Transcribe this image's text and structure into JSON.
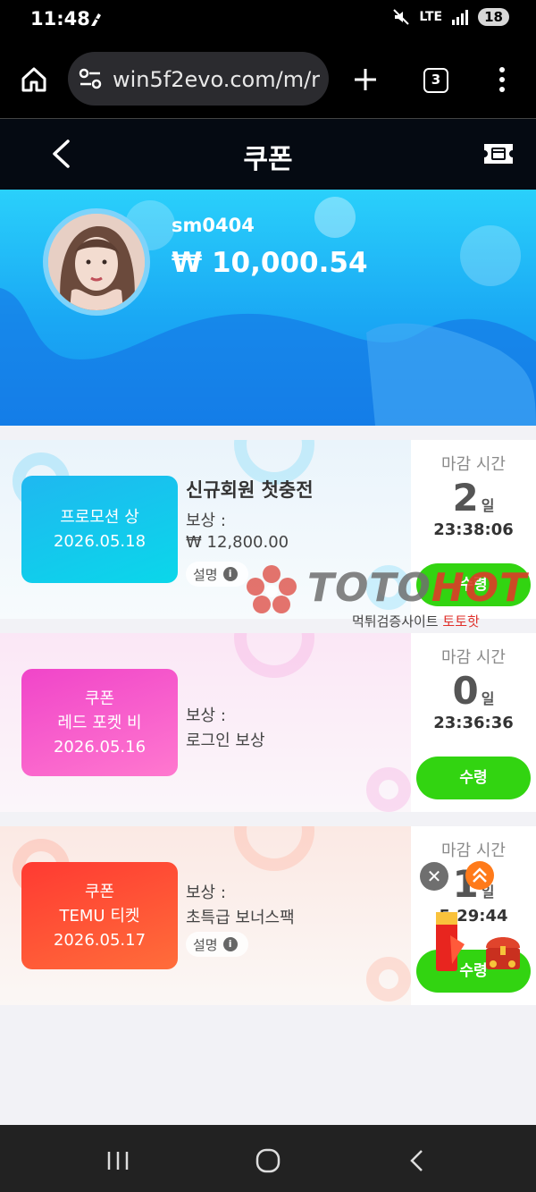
{
  "status_bar": {
    "time": "11:48",
    "network": "LTE",
    "battery": "18"
  },
  "browser": {
    "url": "win5f2evo.com/m/r",
    "tab_count": "3"
  },
  "header": {
    "title": "쿠폰"
  },
  "profile": {
    "username": "sm0404",
    "balance": "₩ 10,000.54"
  },
  "deadline_label": "마감 시간",
  "reward_label": "보상 :",
  "description_label": "설명",
  "claim_label": "수령",
  "days_unit": "일",
  "coupons": [
    {
      "badge_lines": [
        "프로모션 상",
        "2026.05.18"
      ],
      "title": "신규회원 첫충전",
      "reward_value": "₩ 12,800.00",
      "days": "2",
      "time": "23:38:06"
    },
    {
      "badge_lines": [
        "쿠폰",
        "레드 포켓 비",
        "2026.05.16"
      ],
      "title": "",
      "reward_value": "로그인 보상",
      "days": "0",
      "time": "23:36:36"
    },
    {
      "badge_lines": [
        "쿠폰",
        "TEMU 티켓",
        "2026.05.17"
      ],
      "title": "",
      "reward_value": "초특급 보너스팩",
      "days": "1",
      "time": "5:29:44"
    }
  ],
  "watermark": {
    "brand_a": "TOTO",
    "brand_b": "HOT",
    "sub_a": "먹튀검증사이트",
    "sub_b": "토토핫"
  },
  "colors": {
    "banner_top": "#2ad0fb",
    "banner_bottom": "#1690ee",
    "claim_button": "#32d411",
    "badge1": "#1ec9f2",
    "badge2": "#f45fd2",
    "badge3": "#ff4f3a"
  }
}
